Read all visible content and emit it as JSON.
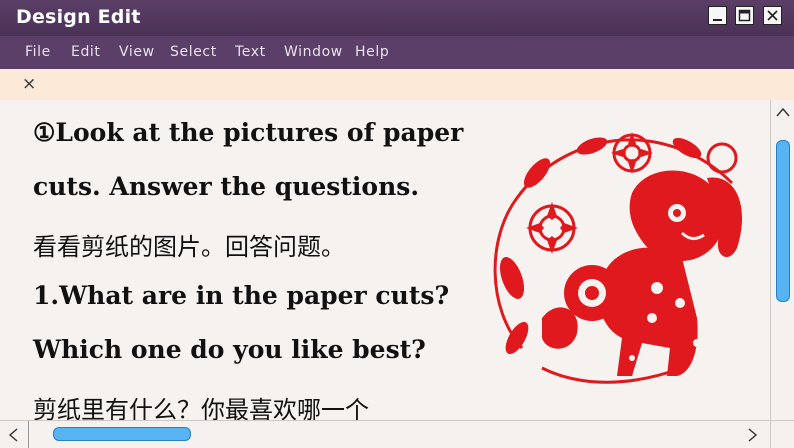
{
  "window": {
    "title": "Design Edit"
  },
  "menu": [
    "File",
    "Edit",
    "View",
    "Select",
    "Text",
    "Window",
    "Help"
  ],
  "tab": {
    "close_glyph": "×"
  },
  "document": {
    "lines": [
      "①Look at the pictures of paper",
      "cuts. Answer the questions.",
      "看看剪纸的图片。回答问题。",
      "1.What are in the paper cuts?",
      "Which one do you like best?",
      "剪纸里有什么？你最喜欢哪一个"
    ],
    "image": {
      "subject": "red paper-cut dog with flowers",
      "icon": "paper-cut-dog-image",
      "color": "#e0191e"
    }
  },
  "colors": {
    "titlebar": "#4c3157",
    "menubar": "#5b3f68",
    "tabbar": "#fde9d7",
    "scroll_thumb": "#56b4f2"
  },
  "scroll": {
    "vertical_position": 0.0,
    "vertical_visible_fraction": 0.55,
    "horizontal_position": 0.0,
    "horizontal_visible_fraction": 0.2
  }
}
